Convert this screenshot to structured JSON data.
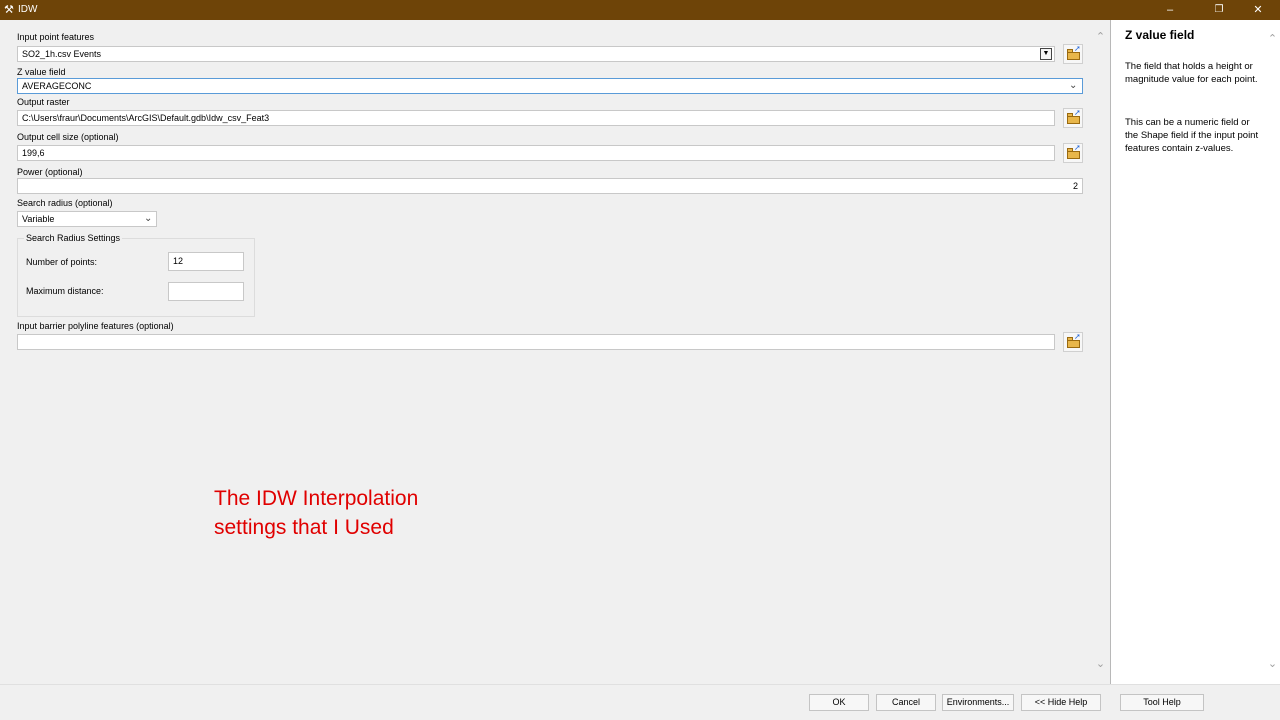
{
  "window": {
    "title": "IDW",
    "minimize_glyph": "–",
    "restore_glyph": "❐",
    "close_glyph": "✕"
  },
  "form": {
    "input_point_features": {
      "label": "Input point features",
      "value": "SO2_1h.csv Events"
    },
    "z_value_field": {
      "label": "Z value field",
      "value": "AVERAGECONC"
    },
    "output_raster": {
      "label": "Output raster",
      "value": "C:\\Users\\fraur\\Documents\\ArcGIS\\Default.gdb\\Idw_csv_Feat3"
    },
    "output_cell_size": {
      "label": "Output cell size (optional)",
      "value": "199,6"
    },
    "power": {
      "label": "Power (optional)",
      "value": "2"
    },
    "search_radius": {
      "label": "Search radius (optional)",
      "value": "Variable"
    },
    "search_radius_settings": {
      "title": "Search Radius Settings",
      "number_of_points": {
        "label": "Number of points:",
        "value": "12"
      },
      "maximum_distance": {
        "label": "Maximum distance:",
        "value": ""
      }
    },
    "barrier": {
      "label": "Input barrier polyline features (optional)",
      "value": ""
    }
  },
  "annotation": {
    "line1": "The IDW Interpolation",
    "line2": "settings that I Used",
    "color": "#e00000"
  },
  "help": {
    "title": "Z value field",
    "para1": "The field that holds a height or magnitude value for each point.",
    "para2": "This can be a numeric field or the Shape field if the input point features contain z-values."
  },
  "buttons": {
    "ok": "OK",
    "cancel": "Cancel",
    "environments": "Environments...",
    "hide_help": "<< Hide Help",
    "tool_help": "Tool Help"
  },
  "colors": {
    "titlebar": "#6e4408",
    "focus_border": "#5a9bd8"
  }
}
